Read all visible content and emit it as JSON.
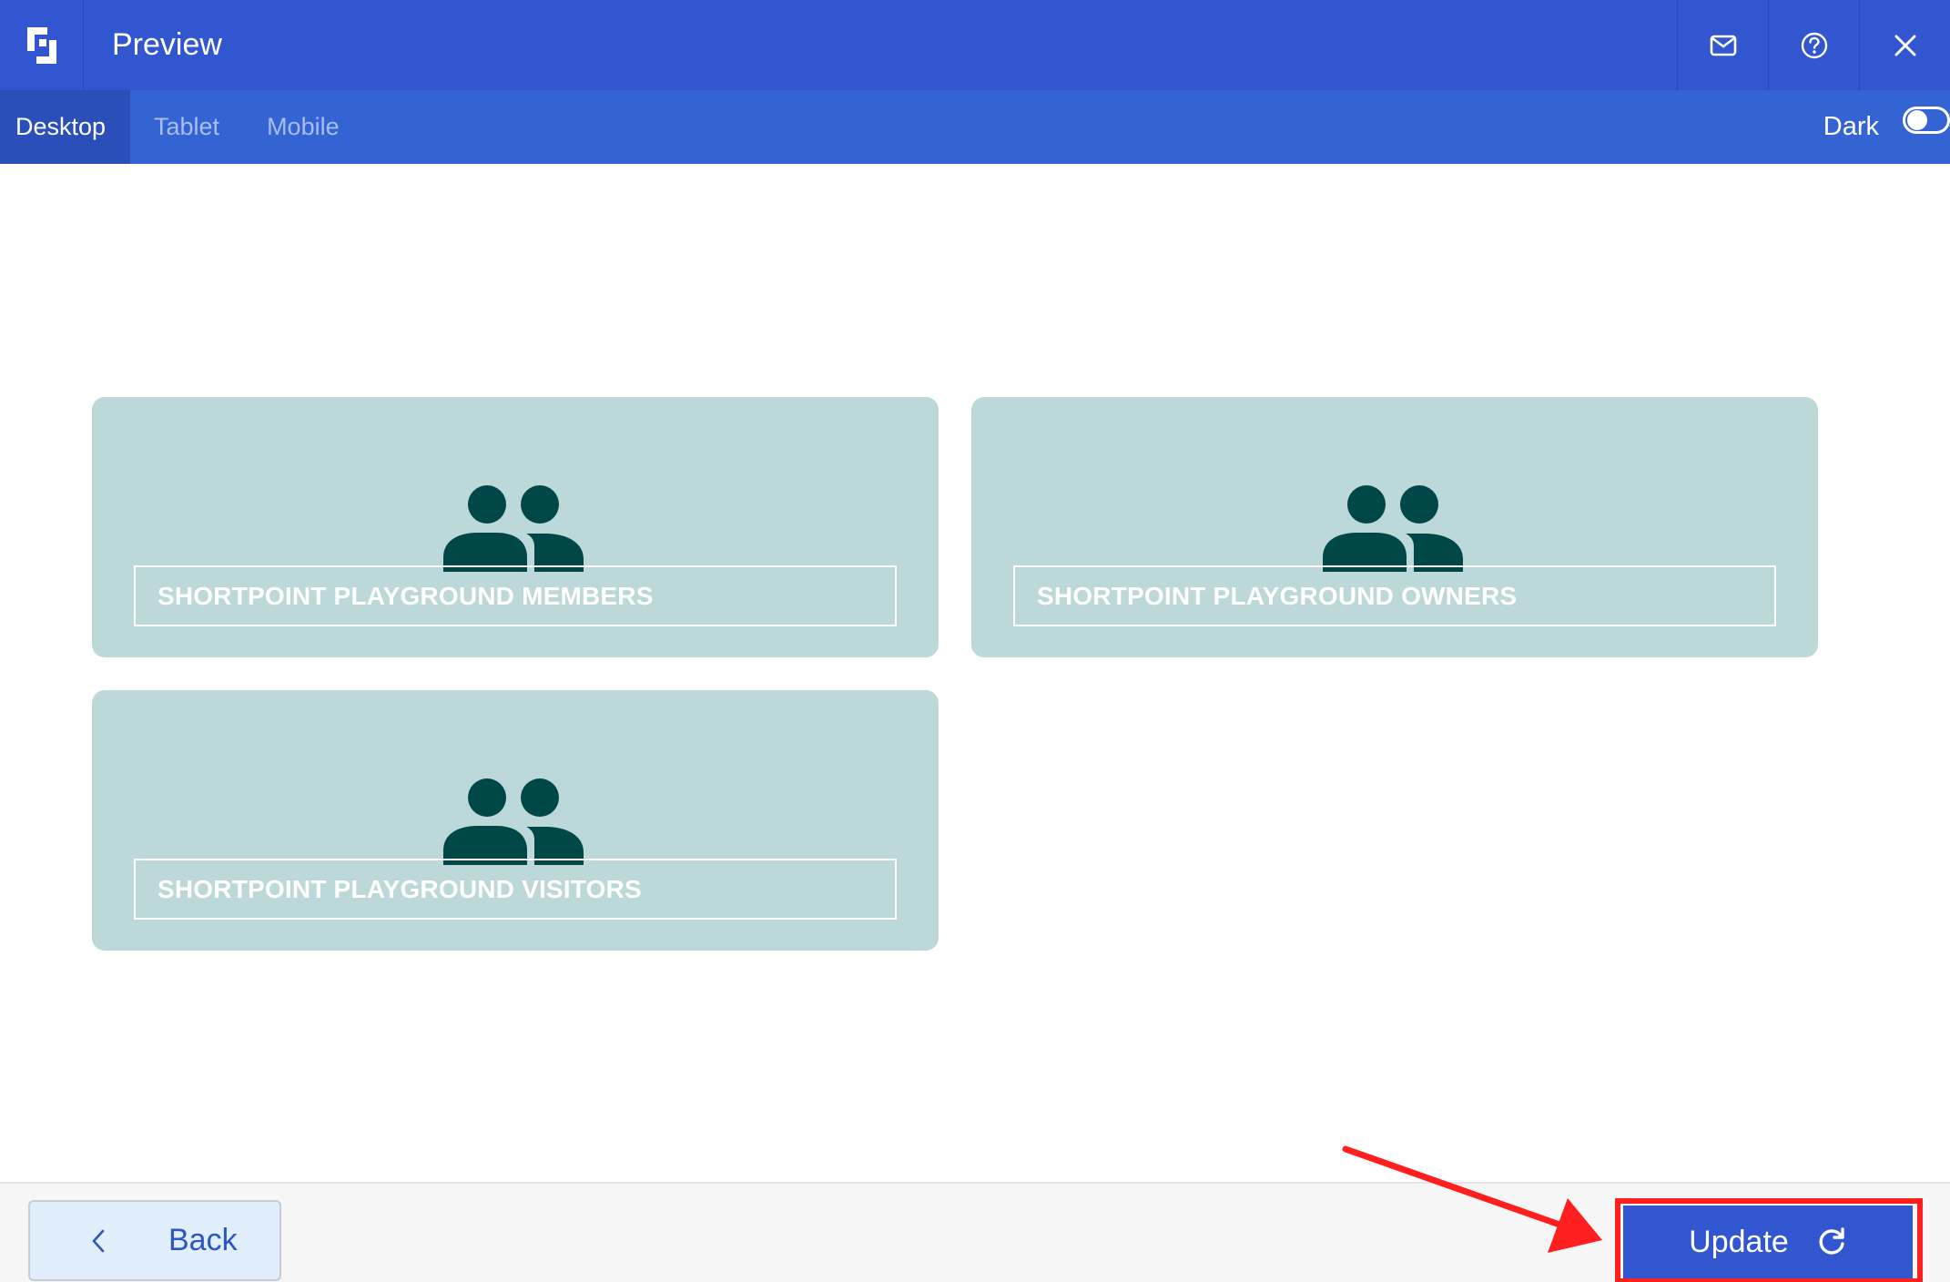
{
  "header": {
    "title": "Preview",
    "icons": [
      "logo-icon",
      "mail-icon",
      "help-icon",
      "close-icon"
    ]
  },
  "tabs": [
    {
      "label": "Desktop",
      "active": true
    },
    {
      "label": "Tablet",
      "active": false
    },
    {
      "label": "Mobile",
      "active": false
    }
  ],
  "dark_toggle": {
    "label": "Dark",
    "on": false
  },
  "cards": [
    {
      "label": "SHORTPOINT PLAYGROUND MEMBERS",
      "icon": "people-icon"
    },
    {
      "label": "SHORTPOINT PLAYGROUND OWNERS",
      "icon": "people-icon"
    },
    {
      "label": "SHORTPOINT PLAYGROUND VISITORS",
      "icon": "people-icon"
    }
  ],
  "footer": {
    "back_label": "Back",
    "update_label": "Update"
  },
  "colors": {
    "header": "#3156cf",
    "tabbar": "#3464d4",
    "card": "#bdd8d9",
    "icon": "#004848",
    "highlight": "#ff1f1f"
  }
}
